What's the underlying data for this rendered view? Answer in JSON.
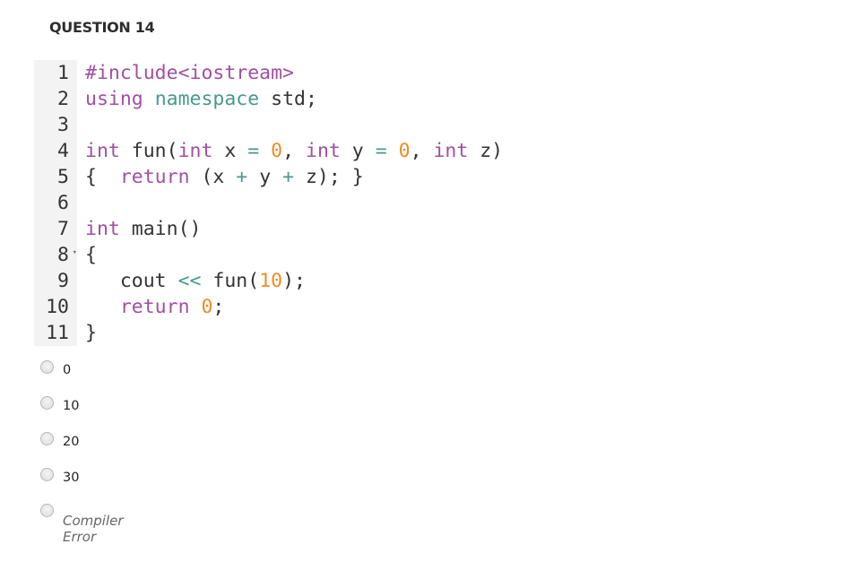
{
  "question": {
    "title": "QUESTION 14"
  },
  "code": {
    "lines": [
      {
        "num": "1",
        "tokens": [
          [
            "pre",
            "#include"
          ],
          [
            "kw",
            "<iostream>"
          ]
        ]
      },
      {
        "num": "2",
        "tokens": [
          [
            "kw",
            "using"
          ],
          [
            "",
            "",
            " "
          ],
          [
            "tl",
            "namespace"
          ],
          [
            "",
            " std;"
          ]
        ]
      },
      {
        "num": "3",
        "tokens": []
      },
      {
        "num": "4",
        "tokens": [
          [
            "kw",
            "int"
          ],
          [
            "",
            " fun("
          ],
          [
            "kw",
            "int"
          ],
          [
            "",
            " x "
          ],
          [
            "op",
            "="
          ],
          [
            "",
            " "
          ],
          [
            "nm",
            "0"
          ],
          [
            "",
            ", "
          ],
          [
            "kw",
            "int"
          ],
          [
            "",
            " y "
          ],
          [
            "op",
            "="
          ],
          [
            "",
            " "
          ],
          [
            "nm",
            "0"
          ],
          [
            "",
            ", "
          ],
          [
            "kw",
            "int"
          ],
          [
            "",
            " z)"
          ]
        ]
      },
      {
        "num": "5",
        "tokens": [
          [
            "",
            "{  "
          ],
          [
            "kw",
            "return"
          ],
          [
            "",
            " (x "
          ],
          [
            "op",
            "+"
          ],
          [
            "",
            " y "
          ],
          [
            "op",
            "+"
          ],
          [
            "",
            " z); }"
          ]
        ]
      },
      {
        "num": "6",
        "tokens": []
      },
      {
        "num": "7",
        "tokens": [
          [
            "kw",
            "int"
          ],
          [
            "",
            " main()"
          ]
        ]
      },
      {
        "num": "8",
        "fold": true,
        "tokens": [
          [
            "",
            "{"
          ]
        ]
      },
      {
        "num": "9",
        "tokens": [
          [
            "",
            "   cout "
          ],
          [
            "op",
            "<<"
          ],
          [
            "",
            " fun("
          ],
          [
            "nm",
            "10"
          ],
          [
            "",
            ");"
          ]
        ]
      },
      {
        "num": "10",
        "tokens": [
          [
            "",
            "   "
          ],
          [
            "kw",
            "return"
          ],
          [
            "",
            " "
          ],
          [
            "nm",
            "0"
          ],
          [
            "",
            ";"
          ]
        ]
      },
      {
        "num": "11",
        "tokens": [
          [
            "",
            "}"
          ]
        ]
      }
    ]
  },
  "options": [
    {
      "label": "0",
      "italic": false
    },
    {
      "label": "10",
      "italic": false
    },
    {
      "label": "20",
      "italic": false
    },
    {
      "label": "30",
      "italic": false
    },
    {
      "label": "Compiler Error",
      "italic": true
    }
  ],
  "icons": {
    "fold": "▾"
  }
}
